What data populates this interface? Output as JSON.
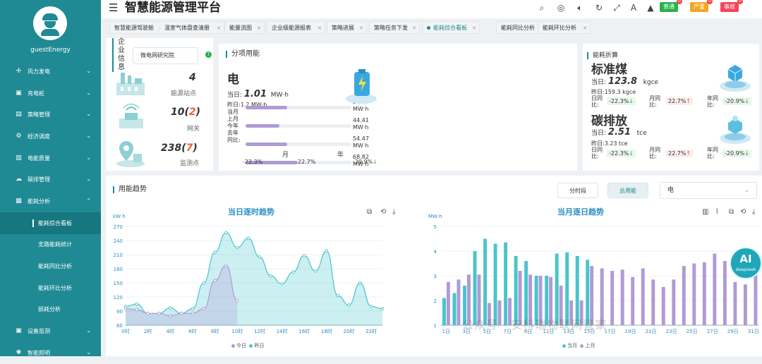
{
  "app": {
    "title": "智慧能源管理平台"
  },
  "user": {
    "name": "guestEnergy"
  },
  "sidebar": {
    "items": [
      {
        "label": "风力发电",
        "icon": "wind-icon"
      },
      {
        "label": "充电桩",
        "icon": "charger-icon"
      },
      {
        "label": "策略管理",
        "icon": "strategy-icon"
      },
      {
        "label": "经济调度",
        "icon": "dispatch-icon"
      },
      {
        "label": "电能质量",
        "icon": "quality-icon"
      },
      {
        "label": "碳排管理",
        "icon": "carbon-icon"
      },
      {
        "label": "能耗分析",
        "icon": "analysis-icon"
      }
    ],
    "subitems": [
      "能耗综合看板",
      "支路能耗统计",
      "能耗同比分析",
      "能耗环比分析",
      "损耗分析"
    ],
    "bottom": [
      {
        "label": "设备监测",
        "icon": "monitor-icon"
      },
      {
        "label": "智能照明",
        "icon": "lighting-icon"
      }
    ]
  },
  "header": {
    "badges": [
      {
        "label": "普通",
        "count": "0",
        "color": "#27b34a"
      },
      {
        "label": "严重",
        "count": "0",
        "color": "#f5a623"
      },
      {
        "label": "事故",
        "count": "0",
        "color": "#f5455c"
      }
    ]
  },
  "tabs": [
    "智慧能源驾驶舱",
    "温室气体盘查清册",
    "能量流图",
    "企业级能源报表",
    "策略进展",
    "策略任务下发",
    "能耗综合看板",
    "能耗同比分析",
    "能耗环比分析"
  ],
  "enterprise": {
    "title": "企业信息",
    "name": "微电网研究院",
    "stats": [
      {
        "value": "4",
        "highlight": "",
        "label": "能源站点"
      },
      {
        "value": "10",
        "highlight": "2",
        "label": "网关"
      },
      {
        "value": "238",
        "highlight": "7",
        "label": "监测点"
      }
    ]
  },
  "itemized": {
    "title": "分项用能",
    "energy": "电",
    "today_label": "当日:",
    "today_value": "1.01",
    "today_unit": "MW·h",
    "row_labels": [
      "昨日:1.2 MW·h",
      "当月",
      "上月",
      "今年",
      "去年",
      "同比:"
    ],
    "bars": [
      {
        "value": "54.47 MW·h",
        "ratio": 0.72
      },
      {
        "value": "44.41 MW·h",
        "ratio": 0.58
      },
      {
        "value": "54.47 MW·h",
        "ratio": 0.72
      },
      {
        "value": "68.82 MW·h",
        "ratio": 0.9
      }
    ],
    "yoy": "-22.3%",
    "mom": "22.7%",
    "yoy2": "-20.9%",
    "month": "月",
    "year": "年"
  },
  "conversion": {
    "title": "能耗折算",
    "items": [
      {
        "name": "标准煤",
        "today": "123.8",
        "unit": "kgce",
        "yesterday": "159.3 kgce",
        "daily": "-22.3%",
        "monthly": "22.7%",
        "yearly": "-20.9%"
      },
      {
        "name": "碳排放",
        "today": "2.51",
        "unit": "tce",
        "yesterday": "3.23 tce",
        "daily": "-22.3%",
        "monthly": "22.7%",
        "yearly": "-20.9%"
      }
    ],
    "labels": {
      "today": "当日:",
      "yesterday": "昨日:",
      "daily": "日同比:",
      "monthly": "月同比:",
      "yearly": "年同比:"
    }
  },
  "trend": {
    "title": "用能趋势",
    "btn_period": "分时段",
    "btn_total": "总用能",
    "select": "电"
  },
  "chart_data": [
    {
      "type": "area",
      "title": "当日逐时趋势",
      "ylabel": "kW·h",
      "ylim": [
        60,
        270
      ],
      "yticks": [
        60,
        90,
        120,
        150,
        180,
        210,
        240,
        270
      ],
      "xticks": [
        "0时",
        "2时",
        "4时",
        "6时",
        "8时",
        "10时",
        "12时",
        "14时",
        "16时",
        "18时",
        "20时",
        "22时"
      ],
      "x": [
        0,
        1,
        2,
        3,
        4,
        5,
        6,
        7,
        8,
        9,
        10,
        11,
        12,
        13,
        14,
        15,
        16,
        17,
        18,
        19,
        20,
        21,
        22,
        23
      ],
      "series": [
        {
          "name": "今日",
          "color": "#b09ad6",
          "values": [
            95,
            93,
            85,
            85,
            80,
            85,
            85,
            95,
            155,
            187,
            112
          ]
        },
        {
          "name": "昨日",
          "color": "#48c5cc",
          "values": [
            100,
            105,
            85,
            85,
            97,
            85,
            95,
            150,
            215,
            257,
            225,
            245,
            205,
            165,
            148,
            173,
            208,
            175,
            218,
            123,
            103,
            150,
            100,
            95
          ]
        }
      ],
      "legend": "bottom"
    },
    {
      "type": "bar",
      "title": "当月逐日趋势",
      "ylabel": "MW·h",
      "ylim": [
        1,
        5
      ],
      "yticks": [
        1,
        2,
        3,
        4,
        5
      ],
      "xticks": [
        "1日",
        "3日",
        "5日",
        "7日",
        "9日",
        "11日",
        "13日",
        "15日",
        "17日",
        "19日",
        "21日",
        "23日",
        "25日",
        "27日",
        "29日",
        "31日"
      ],
      "x": [
        "1日",
        "2日",
        "3日",
        "4日",
        "5日",
        "6日",
        "7日",
        "8日",
        "9日",
        "10日",
        "11日",
        "12日",
        "13日",
        "14日",
        "15日",
        "16日",
        "17日",
        "18日",
        "19日",
        "20日",
        "21日",
        "22日",
        "23日",
        "24日",
        "25日",
        "26日",
        "27日",
        "28日",
        "29日",
        "30日",
        "31日"
      ],
      "series": [
        {
          "name": "当月",
          "color": "#48c5cc",
          "values": [
            2.1,
            2.3,
            2.6,
            4.0,
            4.5,
            4.3,
            4.35,
            3.8,
            3.6,
            3.0,
            3.0,
            3.9,
            3.95,
            3.8,
            3.65
          ]
        },
        {
          "name": "上月",
          "color": "#b09ad6",
          "values": [
            2.75,
            2.85,
            3.05,
            3.05,
            1.9,
            2.0,
            2.1,
            3.2,
            3.05,
            3.0,
            2.95,
            2.6,
            2.0,
            2.0,
            3.4,
            3.3,
            3.2,
            3.25,
            2.95,
            3.3,
            2.85,
            2.55,
            2.85,
            3.4,
            3.5,
            3.55,
            3.9,
            3.6,
            2.75,
            2.65,
            3.25
          ]
        }
      ],
      "legend": "bottom"
    }
  ],
  "ai": {
    "label": "AI",
    "sub": "deepseek"
  },
  "watermark": "公众号 · 安科瑞物联网管家"
}
